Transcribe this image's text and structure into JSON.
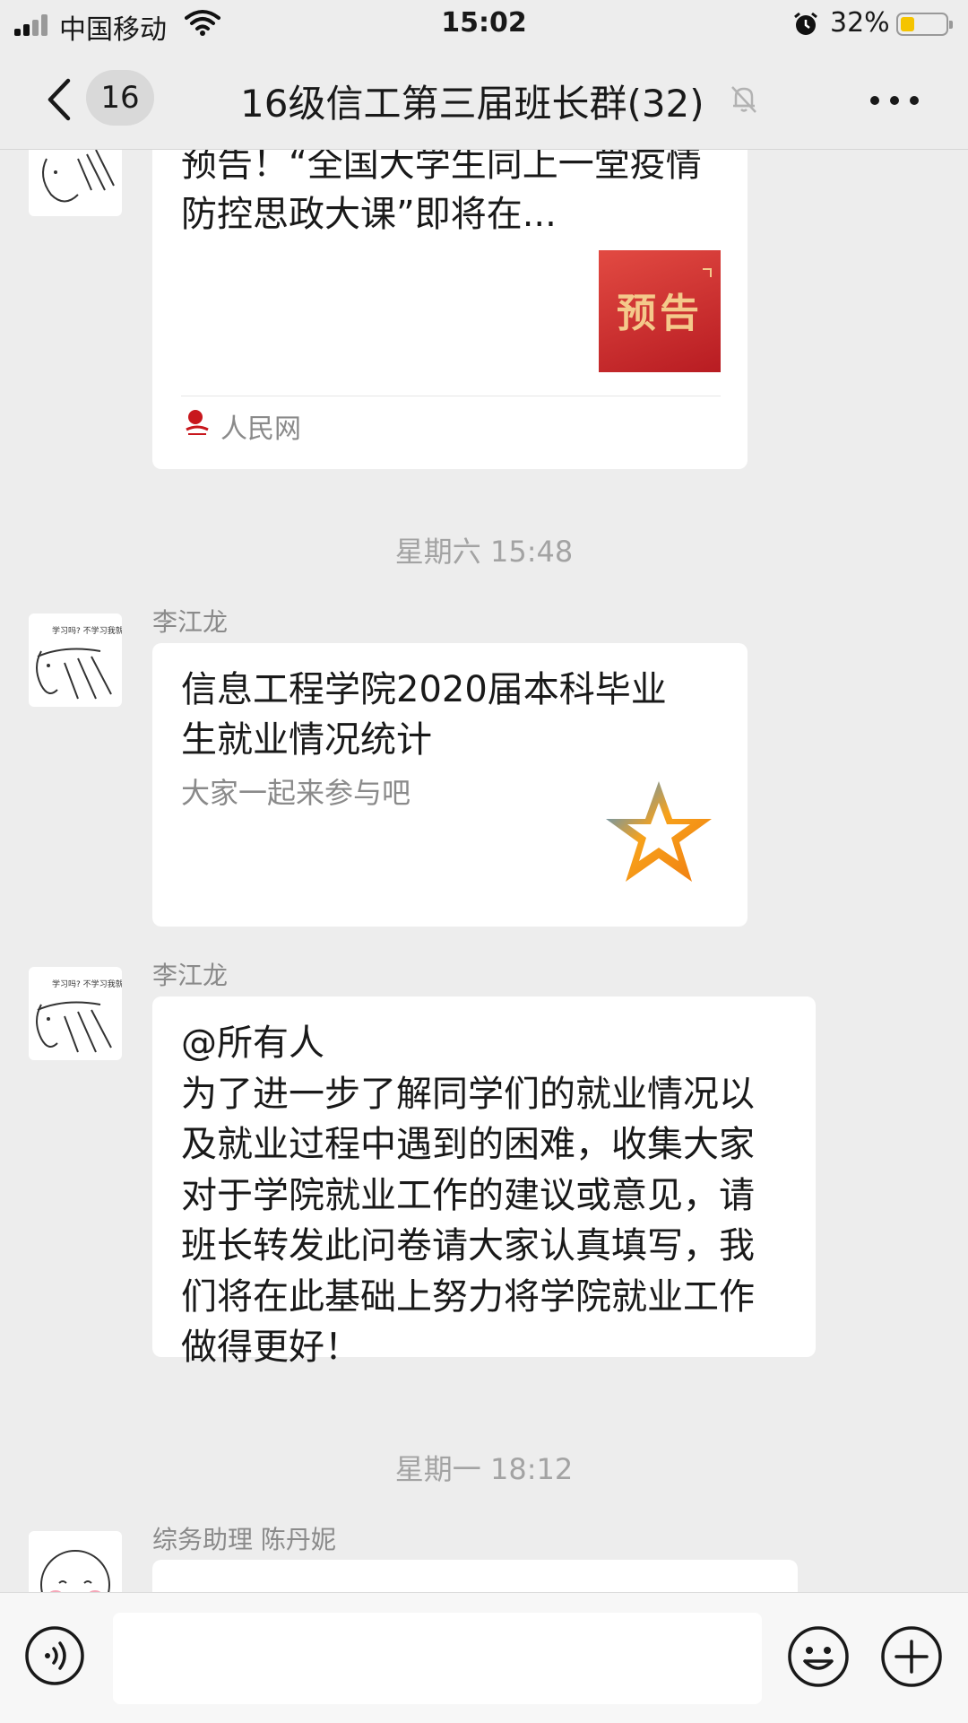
{
  "status_bar": {
    "carrier": "中国移动",
    "time": "15:02",
    "battery_percent": "32%",
    "battery_level": 0.32,
    "battery_color": "#f5c400"
  },
  "nav": {
    "unread_count": "16",
    "title": "16级信工第三届班长群(32)",
    "icons": [
      "chevron-left-icon",
      "mute-bell-icon",
      "more-icon"
    ]
  },
  "messages": {
    "card1": {
      "title": "预告！“全国大学生同上一堂疫情防控思政大课”即将在...",
      "thumb_text": "预告",
      "source": "人民网"
    },
    "time1": "星期六 15:48",
    "card2": {
      "sender": "李江龙",
      "title": "信息工程学院2020届本科毕业生就业情况统计",
      "desc": "大家一起来参与吧",
      "icon": "star-icon"
    },
    "msg3": {
      "sender": "李江龙",
      "text": "@所有人\n为了进一步了解同学们的就业情况以及就业过程中遇到的困难，收集大家对于学院就业工作的建议或意见，请班长转发此问卷请大家认真填写，我们将在此基础上努力将学院就业工作做得更好！"
    },
    "time2": "星期一 18:12",
    "msg4": {
      "sender": "综务助理 陈丹妮"
    }
  },
  "toolbar": {
    "icons": [
      "voice-icon",
      "emoji-icon",
      "plus-icon"
    ],
    "input_value": ""
  }
}
